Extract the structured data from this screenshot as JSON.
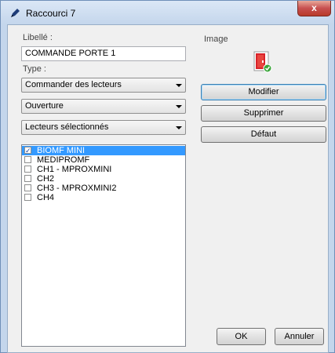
{
  "window": {
    "title": "Raccourci 7",
    "close_symbol": "x"
  },
  "form": {
    "libelle_label": "Libellé :",
    "libelle_value": "COMMANDE PORTE 1",
    "type_label": "Type :",
    "type_value": "Commander des lecteurs",
    "action_value": "Ouverture",
    "selection_value": "Lecteurs sélectionnés"
  },
  "readers": [
    {
      "label": "BIOMF MINI",
      "checked": true,
      "selected": true
    },
    {
      "label": "MEDIPROMF",
      "checked": false,
      "selected": false
    },
    {
      "label": "CH1 - MPROXMINI",
      "checked": false,
      "selected": false
    },
    {
      "label": "CH2",
      "checked": false,
      "selected": false
    },
    {
      "label": "CH3 - MPROXMINI2",
      "checked": false,
      "selected": false
    },
    {
      "label": "CH4",
      "checked": false,
      "selected": false
    }
  ],
  "image_panel": {
    "label": "Image",
    "icon": "door-check-icon",
    "modify_label": "Modifier",
    "delete_label": "Supprimer",
    "default_label": "Défaut"
  },
  "footer": {
    "ok_label": "OK",
    "cancel_label": "Annuler"
  },
  "colors": {
    "selection": "#3399ff",
    "title_bar": "#c4d6ec",
    "close_button": "#c75050"
  }
}
